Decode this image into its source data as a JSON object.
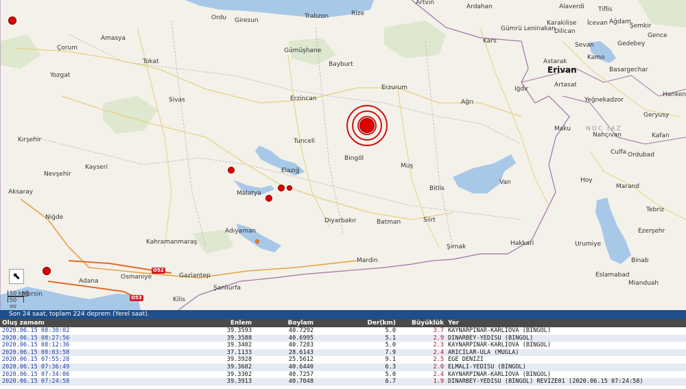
{
  "map": {
    "expand_icon": "arrow-up-left-icon",
    "expand_glyph": "⬉",
    "scale": {
      "km": "50 km",
      "mi": "50 mi"
    },
    "roads": [
      "O52",
      "O53"
    ],
    "cities": [
      {
        "name": "Ordu"
      },
      {
        "name": "Giresun"
      },
      {
        "name": "Trabzon"
      },
      {
        "name": "Rize"
      },
      {
        "name": "Artvin"
      },
      {
        "name": "Ardahan"
      },
      {
        "name": "Alaverdi"
      },
      {
        "name": "Tiflis"
      },
      {
        "name": "Amasya"
      },
      {
        "name": "Çorum"
      },
      {
        "name": "Gümüşhane"
      },
      {
        "name": "Kars"
      },
      {
        "name": "Gümrü Leninakan"
      },
      {
        "name": "Karakilise"
      },
      {
        "name": "Dilican"
      },
      {
        "name": "İcevan"
      },
      {
        "name": "Ağdam"
      },
      {
        "name": "Şemkir"
      },
      {
        "name": "Gence"
      },
      {
        "name": "Gedebey"
      },
      {
        "name": "Tokat"
      },
      {
        "name": "Bayburt"
      },
      {
        "name": "Astarak"
      },
      {
        "name": "Erivan"
      },
      {
        "name": "Sevan"
      },
      {
        "name": "Kamo"
      },
      {
        "name": "Basargechar"
      },
      {
        "name": "Yozgat"
      },
      {
        "name": "Erzurum"
      },
      {
        "name": "Iğdır"
      },
      {
        "name": "Artasat"
      },
      {
        "name": "Sivas"
      },
      {
        "name": "Erzincan"
      },
      {
        "name": "Ağrı"
      },
      {
        "name": "Yeğnekadzor"
      },
      {
        "name": "Hanken"
      },
      {
        "name": "Geryusy"
      },
      {
        "name": "Kırşehir"
      },
      {
        "name": "Tunceli"
      },
      {
        "name": "Maku"
      },
      {
        "name": "NOC (AZ"
      },
      {
        "name": "Nahçıvan"
      },
      {
        "name": "Kafan"
      },
      {
        "name": "Culfa"
      },
      {
        "name": "Ordubad"
      },
      {
        "name": "Kayseri"
      },
      {
        "name": "Bingöl"
      },
      {
        "name": "Muş"
      },
      {
        "name": "Elazığ"
      },
      {
        "name": "Nevşehir"
      },
      {
        "name": "Van"
      },
      {
        "name": "Hoy"
      },
      {
        "name": "Marand"
      },
      {
        "name": "Aksaray"
      },
      {
        "name": "Malatya"
      },
      {
        "name": "Bitlis"
      },
      {
        "name": "Tebriz"
      },
      {
        "name": "Niğde"
      },
      {
        "name": "Diyarbakır"
      },
      {
        "name": "Batman"
      },
      {
        "name": "Siirt"
      },
      {
        "name": "Ezerşehr"
      },
      {
        "name": "Adıyaman"
      },
      {
        "name": "Kahramanmaraş"
      },
      {
        "name": "Şırnak"
      },
      {
        "name": "Hakkari"
      },
      {
        "name": "Urumiye"
      },
      {
        "name": "Mardin"
      },
      {
        "name": "Osmaniye"
      },
      {
        "name": "Gaziantep"
      },
      {
        "name": "Şanlıurfa"
      },
      {
        "name": "Binab"
      },
      {
        "name": "Adana"
      },
      {
        "name": "Eslamabad"
      },
      {
        "name": "Mianduah"
      },
      {
        "name": "Mersin"
      },
      {
        "name": "Kilis"
      }
    ]
  },
  "list": {
    "header": "Son 24 saat, toplam 224 deprem (Yerel saat).",
    "columns": {
      "time": "Oluş zamanı",
      "lat": "Enlem",
      "lon": "Boylam",
      "depth": "Der(km)",
      "mag": "Büyüklük",
      "loc": "Yer"
    },
    "rows": [
      {
        "time": "2020.06.15 08:30:02",
        "lat": "39.3593",
        "lon": "40.7292",
        "depth": "5.0",
        "mag": "3.7",
        "loc": "KAYNARPINAR-KARLIOVA (BINGOL)"
      },
      {
        "time": "2020.06.15 08:27:56",
        "lat": "39.3588",
        "lon": "40.6995",
        "depth": "5.1",
        "mag": "2.9",
        "loc": "DINARBEY-YEDISU (BINGOL)"
      },
      {
        "time": "2020.06.15 08:12:36",
        "lat": "39.3402",
        "lon": "40.7283",
        "depth": "5.0",
        "mag": "2.3",
        "loc": "KAYNARPINAR-KARLIOVA (BINGOL)"
      },
      {
        "time": "2020.06.15 08:03:58",
        "lat": "37.1133",
        "lon": "28.6143",
        "depth": "7.9",
        "mag": "2.4",
        "loc": "ARICILAR-ULA (MUGLA)"
      },
      {
        "time": "2020.06.15 07:55:28",
        "lat": "39.3928",
        "lon": "25.5612",
        "depth": "9.1",
        "mag": "2.5",
        "loc": "EGE DENIZI"
      },
      {
        "time": "2020.06.15 07:36:49",
        "lat": "39.3682",
        "lon": "40.6440",
        "depth": "6.3",
        "mag": "2.0",
        "loc": "ELMALI-YEDISU (BINGOL)"
      },
      {
        "time": "2020.06.15 07:34:06",
        "lat": "39.3302",
        "lon": "40.7257",
        "depth": "5.0",
        "mag": "2.4",
        "loc": "KAYNARPINAR-KARLIOVA (BINGOL)"
      },
      {
        "time": "2020.06.15 07:24:58",
        "lat": "39.3913",
        "lon": "40.7048",
        "depth": "6.7",
        "mag": "1.9",
        "loc": "DINARBEY-YEDISU (BINGOL) REVIZE01 (2020.06.15 07:24:58)"
      }
    ]
  }
}
